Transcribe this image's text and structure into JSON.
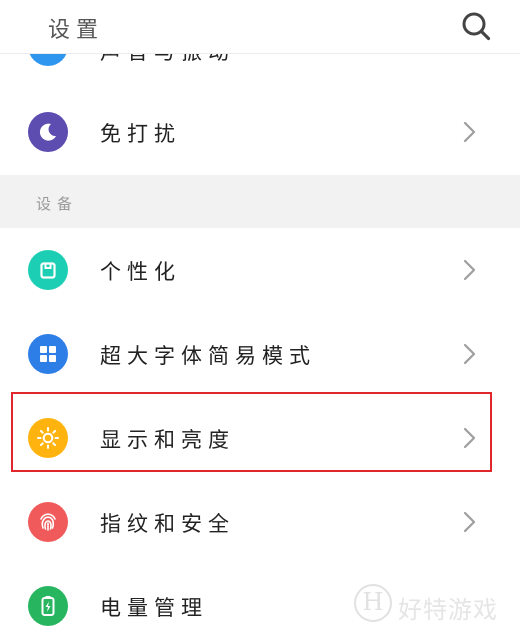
{
  "header": {
    "title": "设置",
    "search_icon": "search-icon"
  },
  "partial_item": {
    "label": "声音与振动",
    "icon": "sound-icon",
    "color": "#2f96f0"
  },
  "items_top": [
    {
      "label": "免打扰",
      "icon": "moon-icon",
      "color": "#5d4db0"
    }
  ],
  "section": {
    "label": "设备"
  },
  "items": [
    {
      "label": "个性化",
      "icon": "theme-icon",
      "color": "#1ccfb4"
    },
    {
      "label": "超大字体简易模式",
      "icon": "grid-icon",
      "color": "#2e7ee8"
    },
    {
      "label": "显示和亮度",
      "icon": "sun-icon",
      "color": "#ffb30f"
    },
    {
      "label": "指纹和安全",
      "icon": "fingerprint-icon",
      "color": "#f05a5a"
    },
    {
      "label": "电量管理",
      "icon": "battery-icon",
      "color": "#27b560"
    }
  ],
  "highlight_color": "#e0272b",
  "watermark": {
    "logo": "H",
    "text": "好特游戏"
  }
}
